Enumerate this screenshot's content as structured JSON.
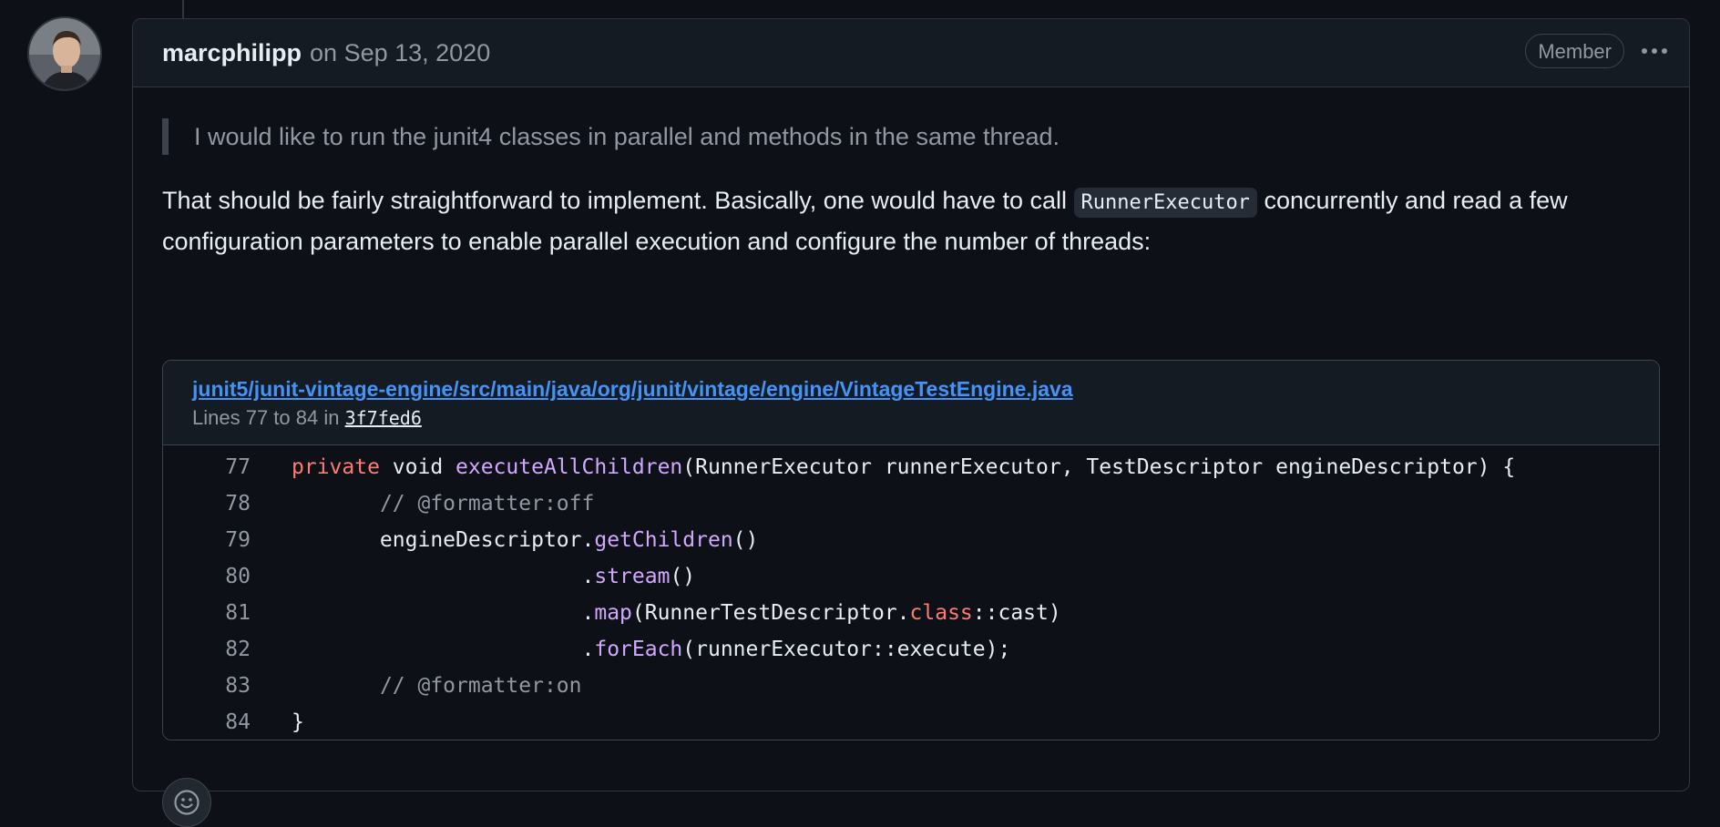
{
  "comment": {
    "author": "marcphilipp",
    "date_text": "on Sep 13, 2020",
    "badge": "Member",
    "avatar_alt": "marcphilipp",
    "quote": "I would like to run the junit4 classes in parallel and methods in the same thread.",
    "body_before": "That should be fairly straightforward to implement. Basically, one would have to call ",
    "body_code": "RunnerExecutor",
    "body_after": " concurrently and read a few configuration parameters to enable parallel execution and configure the number of threads:"
  },
  "snippet": {
    "file_path": "junit5/junit-vintage-engine/src/main/java/org/junit/vintage/engine/VintageTestEngine.java",
    "lines_prefix": "Lines 77 to 84 in ",
    "commit": "3f7fed6",
    "lines": [
      {
        "num": "77",
        "tokens": [
          {
            "t": "private",
            "c": "kw"
          },
          {
            "t": " void ",
            "c": ""
          },
          {
            "t": "executeAllChildren",
            "c": "fn"
          },
          {
            "t": "(RunnerExecutor runnerExecutor, TestDescriptor engineDescriptor) {",
            "c": ""
          }
        ]
      },
      {
        "num": "78",
        "tokens": [
          {
            "t": "       ",
            "c": ""
          },
          {
            "t": "// @formatter:off",
            "c": "cm"
          }
        ]
      },
      {
        "num": "79",
        "tokens": [
          {
            "t": "       engineDescriptor.",
            "c": ""
          },
          {
            "t": "getChildren",
            "c": "fn"
          },
          {
            "t": "()",
            "c": ""
          }
        ]
      },
      {
        "num": "80",
        "tokens": [
          {
            "t": "                       .",
            "c": ""
          },
          {
            "t": "stream",
            "c": "fn"
          },
          {
            "t": "()",
            "c": ""
          }
        ]
      },
      {
        "num": "81",
        "tokens": [
          {
            "t": "                       .",
            "c": ""
          },
          {
            "t": "map",
            "c": "fn"
          },
          {
            "t": "(RunnerTestDescriptor.",
            "c": ""
          },
          {
            "t": "class",
            "c": "kw"
          },
          {
            "t": "::cast)",
            "c": ""
          }
        ]
      },
      {
        "num": "82",
        "tokens": [
          {
            "t": "                       .",
            "c": ""
          },
          {
            "t": "forEach",
            "c": "fn"
          },
          {
            "t": "(runnerExecutor::execute);",
            "c": ""
          }
        ]
      },
      {
        "num": "83",
        "tokens": [
          {
            "t": "       ",
            "c": ""
          },
          {
            "t": "// @formatter:on",
            "c": "cm"
          }
        ]
      },
      {
        "num": "84",
        "tokens": [
          {
            "t": "}",
            "c": ""
          }
        ]
      }
    ]
  },
  "icons": {
    "more": "kebab-horizontal-icon",
    "reaction": "smiley-icon"
  }
}
